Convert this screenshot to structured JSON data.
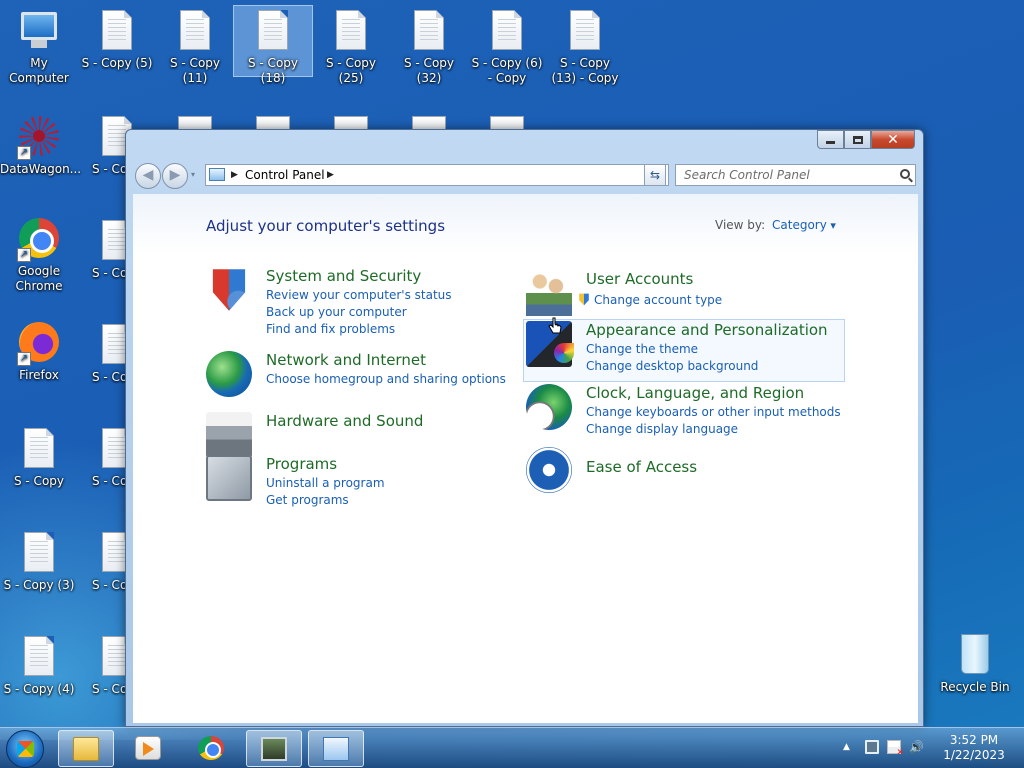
{
  "desktop": {
    "icons": [
      {
        "label": "My Computer"
      },
      {
        "label": "S - Copy (5)"
      },
      {
        "label": "S - Copy (11)"
      },
      {
        "label": "S - Copy (18)"
      },
      {
        "label": "S - Copy (25)"
      },
      {
        "label": "S - Copy (32)"
      },
      {
        "label": "S - Copy (6) - Copy"
      },
      {
        "label": "S - Copy (13) - Copy"
      },
      {
        "label": "DataWagon..."
      },
      {
        "label": "S - Copy"
      },
      {
        "label": "Google Chrome"
      },
      {
        "label": "S - Copy"
      },
      {
        "label": "Firefox"
      },
      {
        "label": "S - Copy"
      },
      {
        "label": "S - Copy"
      },
      {
        "label": "S - Copy"
      },
      {
        "label": "S - Copy (3)"
      },
      {
        "label": "S - Copy"
      },
      {
        "label": "S - Copy (4)"
      },
      {
        "label": "S - Copy"
      },
      {
        "label": "Recycle Bin"
      }
    ]
  },
  "window": {
    "address": "Control Panel",
    "search_placeholder": "Search Control Panel",
    "heading": "Adjust your computer's settings",
    "view_by_label": "View by:",
    "view_by_value": "Category",
    "categories": [
      {
        "title": "System and Security",
        "icon": "shield-icon",
        "links": [
          "Review your computer's status",
          "Back up your computer",
          "Find and fix problems"
        ]
      },
      {
        "title": "Network and Internet",
        "icon": "globe-network-icon",
        "links": [
          "Choose homegroup and sharing options"
        ]
      },
      {
        "title": "Hardware and Sound",
        "icon": "printer-icon",
        "links": []
      },
      {
        "title": "Programs",
        "icon": "programs-icon",
        "links": [
          "Uninstall a program",
          "Get programs"
        ]
      },
      {
        "title": "User Accounts",
        "icon": "users-icon",
        "links": [
          "Change account type"
        ]
      },
      {
        "title": "Appearance and Personalization",
        "icon": "appearance-icon",
        "links": [
          "Change the theme",
          "Change desktop background"
        ]
      },
      {
        "title": "Clock, Language, and Region",
        "icon": "clock-globe-icon",
        "links": [
          "Change keyboards or other input methods",
          "Change display language"
        ]
      },
      {
        "title": "Ease of Access",
        "icon": "ease-of-access-icon",
        "links": []
      }
    ]
  },
  "taskbar": {
    "apps": [
      "windows-explorer",
      "media-player",
      "google-chrome",
      "system-monitor",
      "control-panel"
    ],
    "time": "3:52 PM",
    "date": "1/22/2023"
  }
}
